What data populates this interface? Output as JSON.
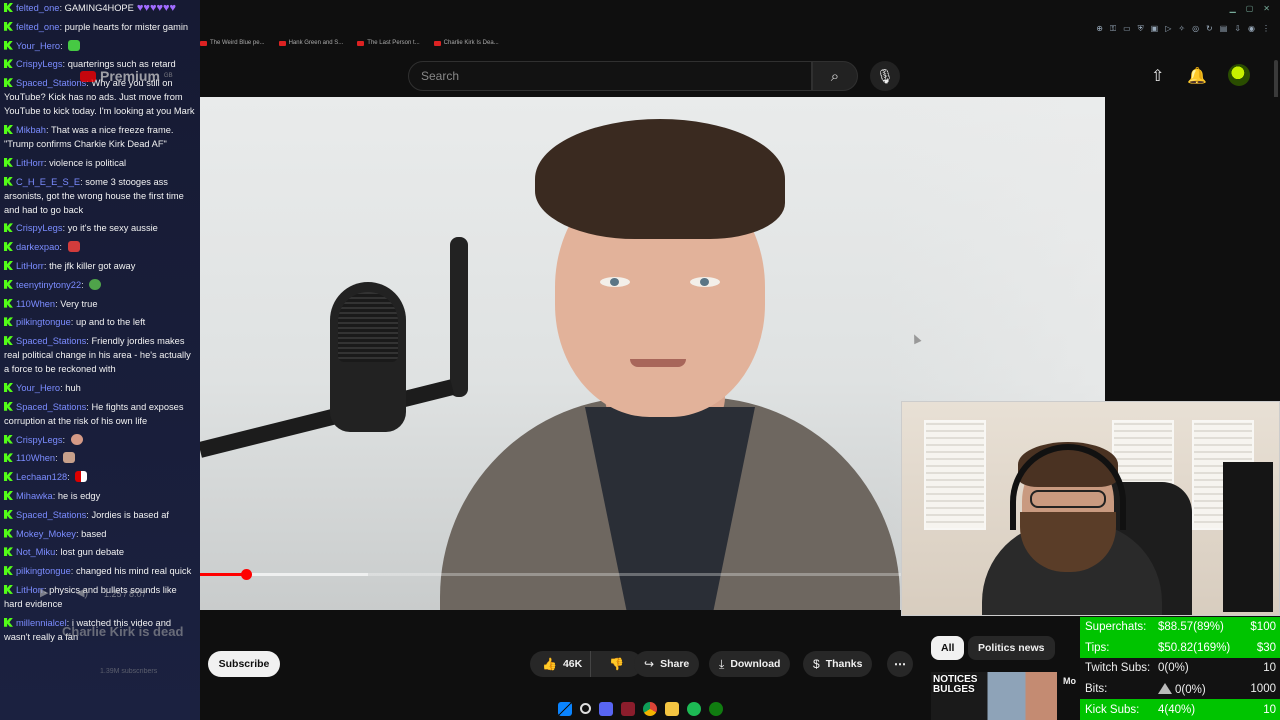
{
  "browser": {
    "bookmarks": [
      "The Weird Blue pe...",
      "Hank Green and S...",
      "The Last Person t...",
      "Charlie Kirk Is Dea..."
    ],
    "extension_icons": [
      "zoom-icon",
      "key-icon",
      "bookmark-icon",
      "shield-icon",
      "extension-icon",
      "play-icon",
      "puzzle-icon",
      "headphones-icon",
      "sync-icon",
      "lock-icon",
      "download-icon",
      "profile-icon",
      "menu-icon"
    ]
  },
  "youtube": {
    "premium_label": "Premium",
    "premium_region": "GB",
    "search_placeholder": "Search"
  },
  "player": {
    "progress_fraction": 0.051,
    "buffer_fraction": 0.186,
    "timecode": "1:25 / 8:07"
  },
  "chat": {
    "messages": [
      {
        "user": "felted_one",
        "text": "GAMING4HOPE",
        "emote": "hearts"
      },
      {
        "user": "felted_one",
        "text": "purple hearts for mister gamin"
      },
      {
        "user": "Your_Hero",
        "text": "",
        "emote": "green"
      },
      {
        "user": "CrispyLegs",
        "text": "quarterings such as retard"
      },
      {
        "user": "Spaced_Stations",
        "text": "Why are you still on YouTube? Kick has no ads. Just move from YouTube to kick today. I'm looking at you Mark"
      },
      {
        "user": "Mikbah",
        "text": "That was a nice freeze frame. \"Trump confirms Charkie Kirk Dead AF\""
      },
      {
        "user": "LitHorr",
        "text": "violence is political"
      },
      {
        "user": "C_H_E_E_S_E",
        "text": "some 3 stooges ass arsonists, got the wrong house the first time and had to go back"
      },
      {
        "user": "CrispyLegs",
        "text": "yo it's the sexy aussie"
      },
      {
        "user": "darkexpao",
        "text": "",
        "emote": "red"
      },
      {
        "user": "LitHorr",
        "text": "the jfk killer got away"
      },
      {
        "user": "teenytinytony22",
        "text": "",
        "emote": "pepe"
      },
      {
        "user": "110When",
        "text": "Very true"
      },
      {
        "user": "pilkingtongue",
        "text": "up and to the left"
      },
      {
        "user": "Spaced_Stations",
        "text": "Friendly jordies makes real political change in his area - he's actually a force to be reckoned with"
      },
      {
        "user": "Your_Hero",
        "text": "huh"
      },
      {
        "user": "Spaced_Stations",
        "text": "He fights and exposes corruption at the risk of his own life"
      },
      {
        "user": "CrispyLegs",
        "text": "",
        "emote": "skin"
      },
      {
        "user": "110When",
        "text": "",
        "emote": "face"
      },
      {
        "user": "Lechaan128",
        "text": "",
        "emote": "flag"
      },
      {
        "user": "Mihawka",
        "text": "he is edgy"
      },
      {
        "user": "Spaced_Stations",
        "text": "Jordies is based af"
      },
      {
        "user": "Mokey_Mokey",
        "text": "based"
      },
      {
        "user": "Not_Miku",
        "text": "lost gun debate"
      },
      {
        "user": "pilkingtongue",
        "text": "changed his mind real quick"
      },
      {
        "user": "LitHorr",
        "text": "physics and bullets sounds like hard evidence"
      },
      {
        "user": "millennialcel",
        "text": "i watched this video and wasn't really a fan"
      }
    ],
    "ghost_title": "Charlie Kirk is dead",
    "ghost_subs": "1.39M subscribers"
  },
  "actions": {
    "subscribe": "Subscribe",
    "likes": "46K",
    "share": "Share",
    "download": "Download",
    "thanks": "Thanks",
    "more": "⋯"
  },
  "chips": {
    "all": "All",
    "politics": "Politics news"
  },
  "recommendation": {
    "thumb_text_1": "NOTICES",
    "thumb_text_2": "BULGES",
    "side_text": "Mo"
  },
  "stats": {
    "superchats": {
      "label": "Superchats:",
      "value": "$88.57(89%)",
      "goal": "$100"
    },
    "tips": {
      "label": "Tips:",
      "value": "$50.82(169%)",
      "goal": "$30"
    },
    "twitch": {
      "label": "Twitch Subs:",
      "value": "0(0%)",
      "goal": "10"
    },
    "bits": {
      "label": "Bits:",
      "value": "0(0%)",
      "goal": "1000"
    },
    "kick": {
      "label": "Kick Subs:",
      "value": "4(40%)",
      "goal": "10"
    }
  },
  "colors": {
    "chat_bg": "#161a33",
    "kick_green": "#53fc18",
    "username": "#7b8cff",
    "progress_red": "#ff0000",
    "stat_highlight": "#00c400"
  }
}
